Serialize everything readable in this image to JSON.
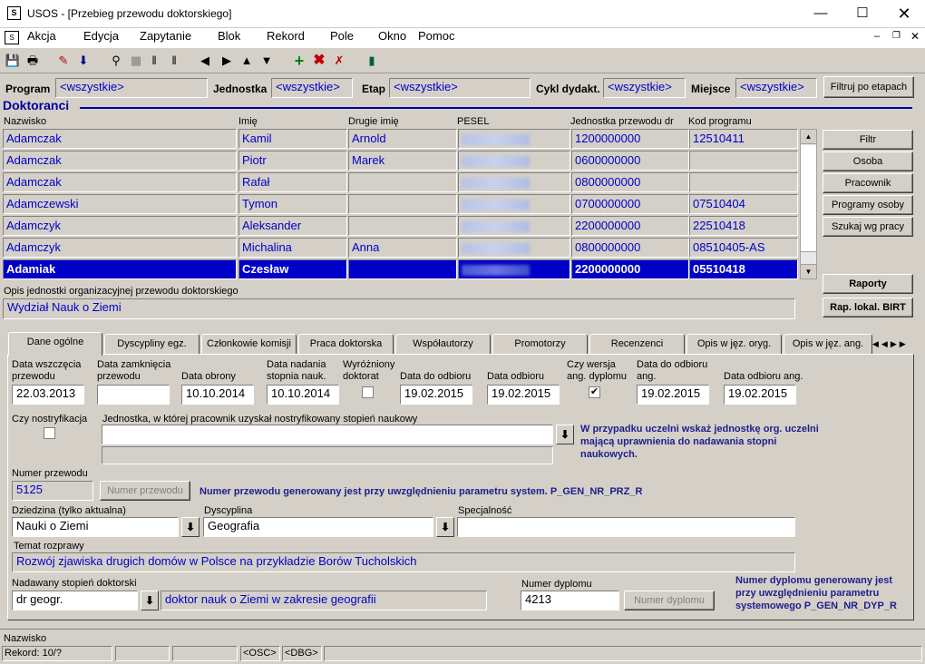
{
  "window": {
    "title": "USOS - [Przebieg przewodu doktorskiego]"
  },
  "menu": [
    "Akcja",
    "Edycja",
    "Zapytanie",
    "Blok",
    "Rekord",
    "Pole",
    "Okno",
    "Pomoc"
  ],
  "filterbar": {
    "program_label": "Program",
    "program_value": "<wszystkie>",
    "jednostka_label": "Jednostka",
    "jednostka_value": "<wszystkie>",
    "etap_label": "Etap",
    "etap_value": "<wszystkie>",
    "cykl_label": "Cykl dydakt.",
    "cykl_value": "<wszystkie>",
    "miejsce_label": "Miejsce",
    "miejsce_value": "<wszystkie>",
    "filtruj_button": "Filtruj po etapach"
  },
  "section_title": "Doktoranci",
  "table": {
    "headers": [
      "Nazwisko",
      "Imię",
      "Drugie imię",
      "PESEL",
      "Jednostka przewodu dr",
      "Kod programu"
    ],
    "rows": [
      {
        "nazwisko": "Adamczak",
        "imie": "Kamil",
        "drugie": "Arnold",
        "jednostka": "1200000000",
        "kod": "12510411"
      },
      {
        "nazwisko": "Adamczak",
        "imie": "Piotr",
        "drugie": "Marek",
        "jednostka": "0600000000",
        "kod": ""
      },
      {
        "nazwisko": "Adamczak",
        "imie": "Rafał",
        "drugie": "",
        "jednostka": "0800000000",
        "kod": ""
      },
      {
        "nazwisko": "Adamczewski",
        "imie": "Tymon",
        "drugie": "",
        "jednostka": "0700000000",
        "kod": "07510404"
      },
      {
        "nazwisko": "Adamczyk",
        "imie": "Aleksander",
        "drugie": "",
        "jednostka": "2200000000",
        "kod": "22510418"
      },
      {
        "nazwisko": "Adamczyk",
        "imie": "Michalina",
        "drugie": "Anna",
        "jednostka": "0800000000",
        "kod": "08510405-AS"
      },
      {
        "nazwisko": "Adamiak",
        "imie": "Czesław",
        "drugie": "",
        "jednostka": "2200000000",
        "kod": "05510418"
      }
    ],
    "selected_index": 6
  },
  "side_buttons": [
    "Filtr",
    "Osoba",
    "Pracownik",
    "Programy osoby",
    "Szukaj wg pracy"
  ],
  "report_buttons": [
    "Raporty",
    "Rap. lokal. BIRT"
  ],
  "opis": {
    "label": "Opis jednostki organizacyjnej przewodu doktorskiego",
    "value": "Wydział Nauk o Ziemi"
  },
  "tabs": [
    "Dane ogólne",
    "Dyscypliny egz.",
    "Członkowie komisji",
    "Praca doktorska",
    "Współautorzy",
    "Promotorzy",
    "Recenzenci",
    "Opis w jęz. oryg.",
    "Opis w jęz. ang."
  ],
  "dates": {
    "wszczecia_label": "Data wszczęcia przewodu",
    "wszczecia": "22.03.2013",
    "zamkniecia_label": "Data zamknięcia przewodu",
    "zamkniecia": "",
    "obrony_label": "Data obrony",
    "obrony": "10.10.2014",
    "nadania_label": "Data nadania stopnia nauk.",
    "nadania": "10.10.2014",
    "wyrozniony_label": "Wyróżniony doktorat",
    "wyrozniony": false,
    "do_odbioru_label": "Data do odbioru",
    "do_odbioru": "19.02.2015",
    "odbioru_label": "Data odbioru",
    "odbioru": "19.02.2015",
    "wersja_ang_label": "Czy wersja ang. dyplomu",
    "wersja_ang": true,
    "do_odbioru_ang_label": "Data do odbioru ang.",
    "do_odbioru_ang": "19.02.2015",
    "odbioru_ang_label": "Data odbioru ang.",
    "odbioru_ang": "19.02.2015"
  },
  "nostryfikacja": {
    "label": "Czy nostryfikacja",
    "checked": false,
    "jednostka_label": "Jednostka, w której pracownik uzyskał nostryfikowany stopień naukowy",
    "jednostka_value": "",
    "note": "W przypadku uczelni wskaż jednostkę org. uczelni mającą uprawnienia do nadawania stopni naukowych."
  },
  "numer_przewodu": {
    "label": "Numer przewodu",
    "value": "5125",
    "button": "Numer przewodu",
    "note": "Numer przewodu generowany jest przy uwzględnieniu parametru system. P_GEN_NR_PRZ_R"
  },
  "dziedzina": {
    "label": "Dziedzina (tylko aktualna)",
    "value": "Nauki o Ziemi"
  },
  "dyscyplina": {
    "label": "Dyscyplina",
    "value": "Geografia"
  },
  "specjalnosc": {
    "label": "Specjalność",
    "value": ""
  },
  "temat": {
    "label": "Temat rozprawy",
    "value": "Rozwój zjawiska drugich domów w Polsce na przykładzie Borów Tucholskich"
  },
  "stopien": {
    "label": "Nadawany stopień doktorski",
    "value": "dr geogr.",
    "opis": "doktor nauk o Ziemi w zakresie geografii"
  },
  "numer_dyplomu": {
    "label": "Numer dyplomu",
    "value": "4213",
    "button": "Numer dyplomu",
    "note": "Numer dyplomu generowany jest przy uwzględnieniu parametru systemowego P_GEN_NR_DYP_R"
  },
  "status": {
    "field": "Nazwisko",
    "record": "Rekord: 10/?",
    "osc": "<OSC>",
    "dbg": "<DBG>"
  }
}
